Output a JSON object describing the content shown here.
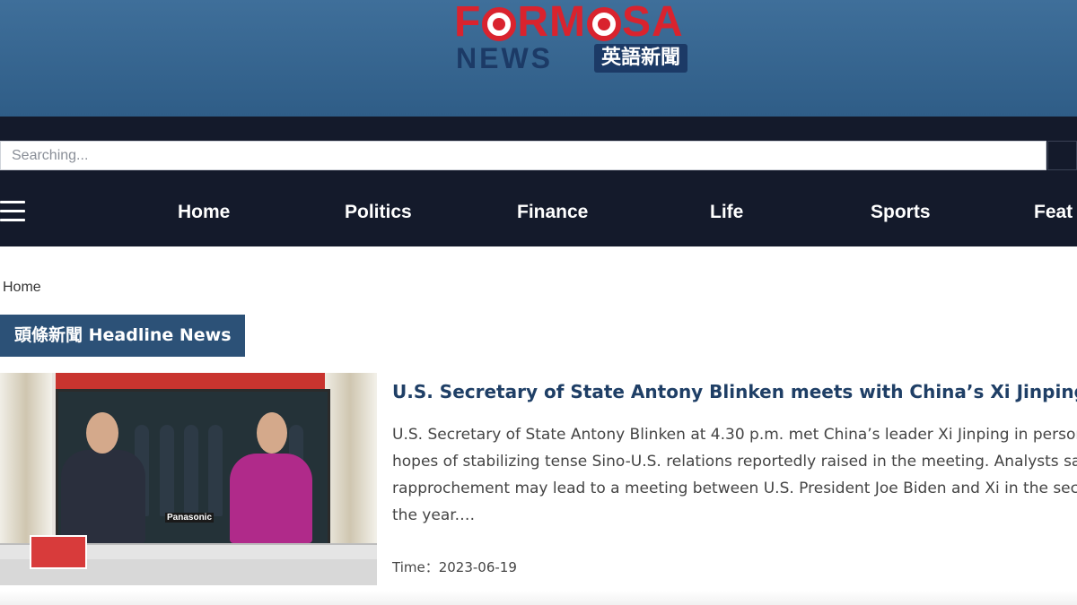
{
  "logo": {
    "formosa_pre": "F",
    "formosa_mid": "RM",
    "formosa_post": "SA",
    "news": "NEWS",
    "chinese": "英語新聞"
  },
  "search": {
    "placeholder": "Searching..."
  },
  "nav": {
    "menu_icon": "hamburger-menu-icon",
    "items": [
      {
        "label": "Home"
      },
      {
        "label": "Politics"
      },
      {
        "label": "Finance"
      },
      {
        "label": "Life"
      },
      {
        "label": "Sports"
      },
      {
        "label": "Feat"
      }
    ]
  },
  "breadcrumb": {
    "current": "Home"
  },
  "section": {
    "title": "頭條新聞 Headline News"
  },
  "article": {
    "title": "U.S. Secretary of State Antony Blinken meets with China’s Xi Jinping",
    "summary_lines": [
      "U.S. Secretary of State Antony Blinken at 4.30 p.m. met China’s leader Xi Jinping in person",
      "hopes of stabilizing tense Sino-U.S. relations reportedly raised in the meeting. Analysts say",
      "rapprochement may lead to a meeting between U.S. President Joe Biden and Xi in the sec",
      "the year.…"
    ],
    "time_label": "Time：",
    "time_value": "2023-06-19",
    "thumbnail_text": "Panasonic"
  },
  "colors": {
    "header_top": "#3f6f9a",
    "nav_background": "#141a2b",
    "brand_red": "#d9232e",
    "brand_navy": "#1c3a66",
    "section_head": "#2c5177",
    "title_blue": "#1f3f66"
  }
}
